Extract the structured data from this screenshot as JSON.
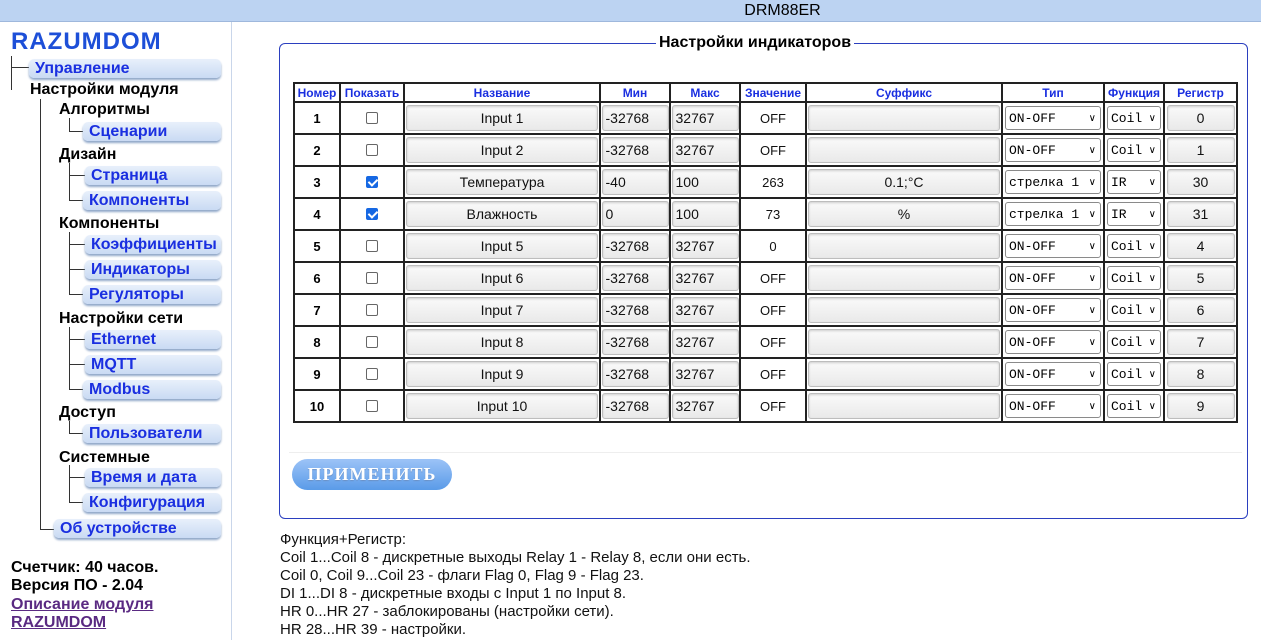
{
  "window_title": "DRM88ER",
  "sidebar": {
    "logo": "RAZUMDOM",
    "top_item": "Управление",
    "section_module": "Настройки модуля",
    "groups": [
      {
        "title": "Алгоритмы",
        "items": [
          "Сценарии"
        ]
      },
      {
        "title": "Дизайн",
        "items": [
          "Страница",
          "Компоненты"
        ]
      },
      {
        "title": "Компоненты",
        "items": [
          "Коэффициенты",
          "Индикаторы",
          "Регуляторы"
        ]
      },
      {
        "title": "Настройки сети",
        "items": [
          "Ethernet",
          "MQTT",
          "Modbus"
        ]
      },
      {
        "title": "Доступ",
        "items": [
          "Пользователи"
        ]
      },
      {
        "title": "Системные",
        "items": [
          "Время и дата",
          "Конфигурация"
        ]
      }
    ],
    "about": "Об устройстве",
    "counter": "Счетчик: 40 часов.",
    "version": "Версия ПО - 2.04",
    "link_line1": "Описание модуля",
    "link_line2": "RAZUMDOM"
  },
  "panel": {
    "title": "Настройки индикаторов",
    "apply_label": "ПРИМЕНИТЬ"
  },
  "table": {
    "headers": [
      "Номер",
      "Показать",
      "Название",
      "Мин",
      "Макс",
      "Значение",
      "Суффикс",
      "Тип",
      "Функция",
      "Регистр"
    ],
    "rows": [
      {
        "num": "1",
        "show": false,
        "name": "Input 1",
        "min": "-32768",
        "max": "32767",
        "value": "OFF",
        "suffix": "",
        "type": "ON-OFF",
        "func": "Coil",
        "reg": "0"
      },
      {
        "num": "2",
        "show": false,
        "name": "Input 2",
        "min": "-32768",
        "max": "32767",
        "value": "OFF",
        "suffix": "",
        "type": "ON-OFF",
        "func": "Coil",
        "reg": "1"
      },
      {
        "num": "3",
        "show": true,
        "name": "Температура",
        "min": "-40",
        "max": "100",
        "value": "263",
        "suffix": "0.1;°C",
        "type": "стрелка 1",
        "func": "IR",
        "reg": "30"
      },
      {
        "num": "4",
        "show": true,
        "name": "Влажность",
        "min": "0",
        "max": "100",
        "value": "73",
        "suffix": "%",
        "type": "стрелка 1",
        "func": "IR",
        "reg": "31"
      },
      {
        "num": "5",
        "show": false,
        "name": "Input 5",
        "min": "-32768",
        "max": "32767",
        "value": "0",
        "suffix": "",
        "type": "ON-OFF",
        "func": "Coil",
        "reg": "4"
      },
      {
        "num": "6",
        "show": false,
        "name": "Input 6",
        "min": "-32768",
        "max": "32767",
        "value": "OFF",
        "suffix": "",
        "type": "ON-OFF",
        "func": "Coil",
        "reg": "5"
      },
      {
        "num": "7",
        "show": false,
        "name": "Input 7",
        "min": "-32768",
        "max": "32767",
        "value": "OFF",
        "suffix": "",
        "type": "ON-OFF",
        "func": "Coil",
        "reg": "6"
      },
      {
        "num": "8",
        "show": false,
        "name": "Input 8",
        "min": "-32768",
        "max": "32767",
        "value": "OFF",
        "suffix": "",
        "type": "ON-OFF",
        "func": "Coil",
        "reg": "7"
      },
      {
        "num": "9",
        "show": false,
        "name": "Input 9",
        "min": "-32768",
        "max": "32767",
        "value": "OFF",
        "suffix": "",
        "type": "ON-OFF",
        "func": "Coil",
        "reg": "8"
      },
      {
        "num": "10",
        "show": false,
        "name": "Input 10",
        "min": "-32768",
        "max": "32767",
        "value": "OFF",
        "suffix": "",
        "type": "ON-OFF",
        "func": "Coil",
        "reg": "9"
      }
    ]
  },
  "notes": [
    "Функция+Регистр:",
    "Coil 1...Coil 8 - дискретные выходы Relay 1 - Relay 8, если они есть.",
    "Coil 0, Coil 9...Coil 23 - флаги Flag 0, Flag 9 - Flag 23.",
    "DI 1...DI 8 - дискретные входы с Input 1 по Input 8.",
    "HR 0...HR 27 - заблокированы (настройки сети).",
    "HR 28...HR 39 - настройки."
  ],
  "colors": {
    "accent": "#1a2fe0",
    "panel_border": "#2b3fbf",
    "topbar": "#bcd3f2",
    "checkbox_on": "#1668e3"
  }
}
